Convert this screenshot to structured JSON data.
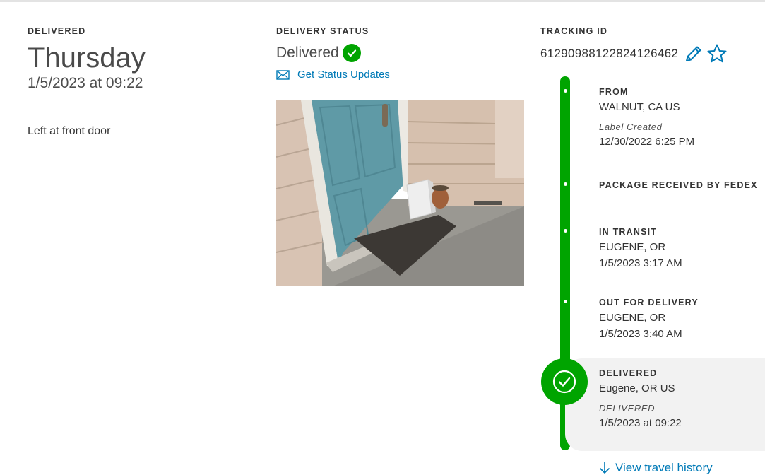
{
  "delivered": {
    "label": "DELIVERED",
    "day": "Thursday",
    "datetime": "1/5/2023 at 09:22",
    "note": "Left at front door"
  },
  "delivery_status": {
    "label": "DELIVERY STATUS",
    "status": "Delivered",
    "updates_link": "Get Status Updates"
  },
  "tracking": {
    "label": "TRACKING ID",
    "number": "612909881228241264​62"
  },
  "timeline": {
    "from": {
      "label": "FROM",
      "location": "WALNUT, CA US",
      "sub_label": "Label Created",
      "datetime": "12/30/2022 6:25 PM"
    },
    "received": {
      "label": "PACKAGE RECEIVED BY FEDEX"
    },
    "in_transit": {
      "label": "IN TRANSIT",
      "location": "EUGENE, OR",
      "datetime": "1/5/2023 3:17 AM"
    },
    "out_for_delivery": {
      "label": "OUT FOR DELIVERY",
      "location": "EUGENE, OR",
      "datetime": "1/5/2023 3:40 AM"
    },
    "delivered": {
      "label": "DELIVERED",
      "location": "Eugene, OR US",
      "sub_label": "DELIVERED",
      "datetime": "1/5/2023 at 09:22"
    }
  },
  "history_link": "View travel history",
  "colors": {
    "accent_green": "#00a400",
    "link_blue": "#007ab7"
  }
}
